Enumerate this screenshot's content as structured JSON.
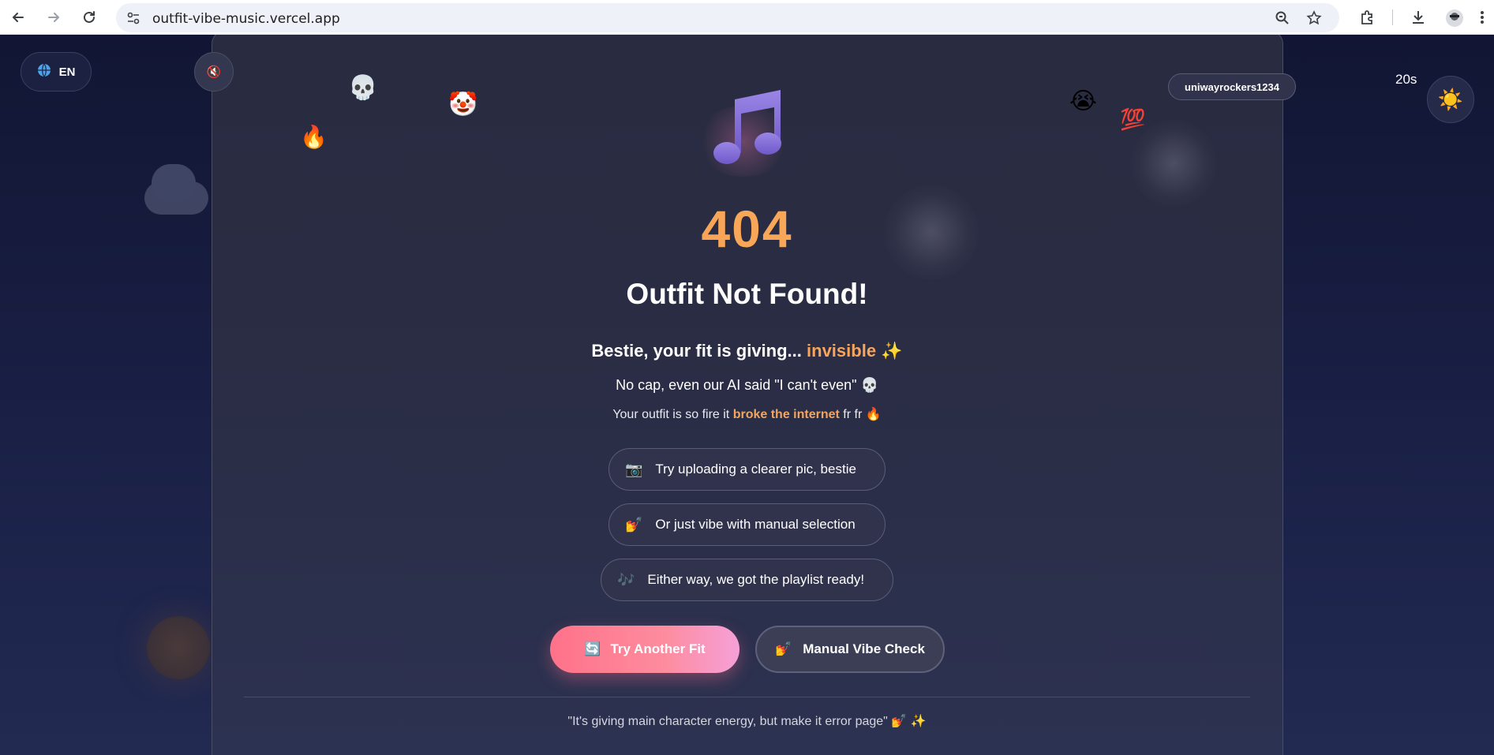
{
  "browser": {
    "url": "outfit-vibe-music.vercel.app",
    "icons": [
      "back-icon",
      "forward-icon",
      "reload-icon",
      "site-info-icon",
      "zoom-icon",
      "star-icon",
      "extensions-icon",
      "download-icon",
      "profile-icon",
      "menu-icon"
    ]
  },
  "header": {
    "language_label": "EN",
    "language_icon": "globe",
    "mute_icon": "🔇",
    "username": "uniwayrockers1234",
    "timer": "20s",
    "theme_icon": "☀️"
  },
  "floating_emojis": {
    "skull": "💀",
    "clown": "🤡",
    "fire": "🔥",
    "crying": "😭",
    "hundred": "💯"
  },
  "main": {
    "error_code": "404",
    "title": "Outfit Not Found!",
    "subtitle_prefix": "Bestie, your fit is giving...",
    "subtitle_highlight": "invisible",
    "subtitle_emoji": "✨",
    "line2": "No cap, even our AI said \"I can't even\" 💀",
    "line3_prefix": "Your outfit is so fire it",
    "line3_highlight": "broke the internet",
    "line3_suffix": "fr fr 🔥"
  },
  "tips": [
    {
      "icon": "📷",
      "text": "Try uploading a clearer pic, bestie"
    },
    {
      "icon": "💅",
      "text": "Or just vibe with manual selection"
    },
    {
      "icon": "🎶",
      "text": "Either way, we got the playlist ready!"
    }
  ],
  "actions": {
    "primary_icon": "🔄",
    "primary_label": "Try Another Fit",
    "secondary_icon": "💅",
    "secondary_label": "Manual Vibe Check"
  },
  "footer": {
    "quote": "\"It's giving main character energy, but make it error page\" 💅 ✨"
  },
  "colors": {
    "accent_orange": "#f7a55c",
    "primary_button": "#ff7289",
    "background": "#171a33"
  }
}
